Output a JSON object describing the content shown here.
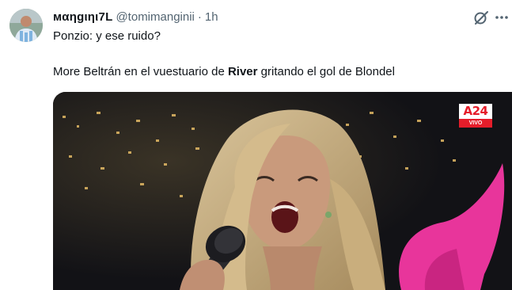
{
  "tweet": {
    "display_name": "мαηgιηι7L",
    "handle": "@tomimanginii",
    "separator": "·",
    "time": "1h",
    "text_line1": "Ponzio: y ese ruido?",
    "text_line2_before": "More Beltrán en el vuestuario de ",
    "text_line2_bold": "River",
    "text_line2_after": " gritando el gol de Blondel"
  },
  "media": {
    "channel_logo": "A24",
    "channel_live": "VIVO"
  },
  "icons": {
    "grok": "grok-icon",
    "more": "more-icon"
  },
  "colors": {
    "text": "#0f1419",
    "secondary": "#536471",
    "channel_red": "#e51d2a",
    "pink_chair": "#e8359b"
  }
}
